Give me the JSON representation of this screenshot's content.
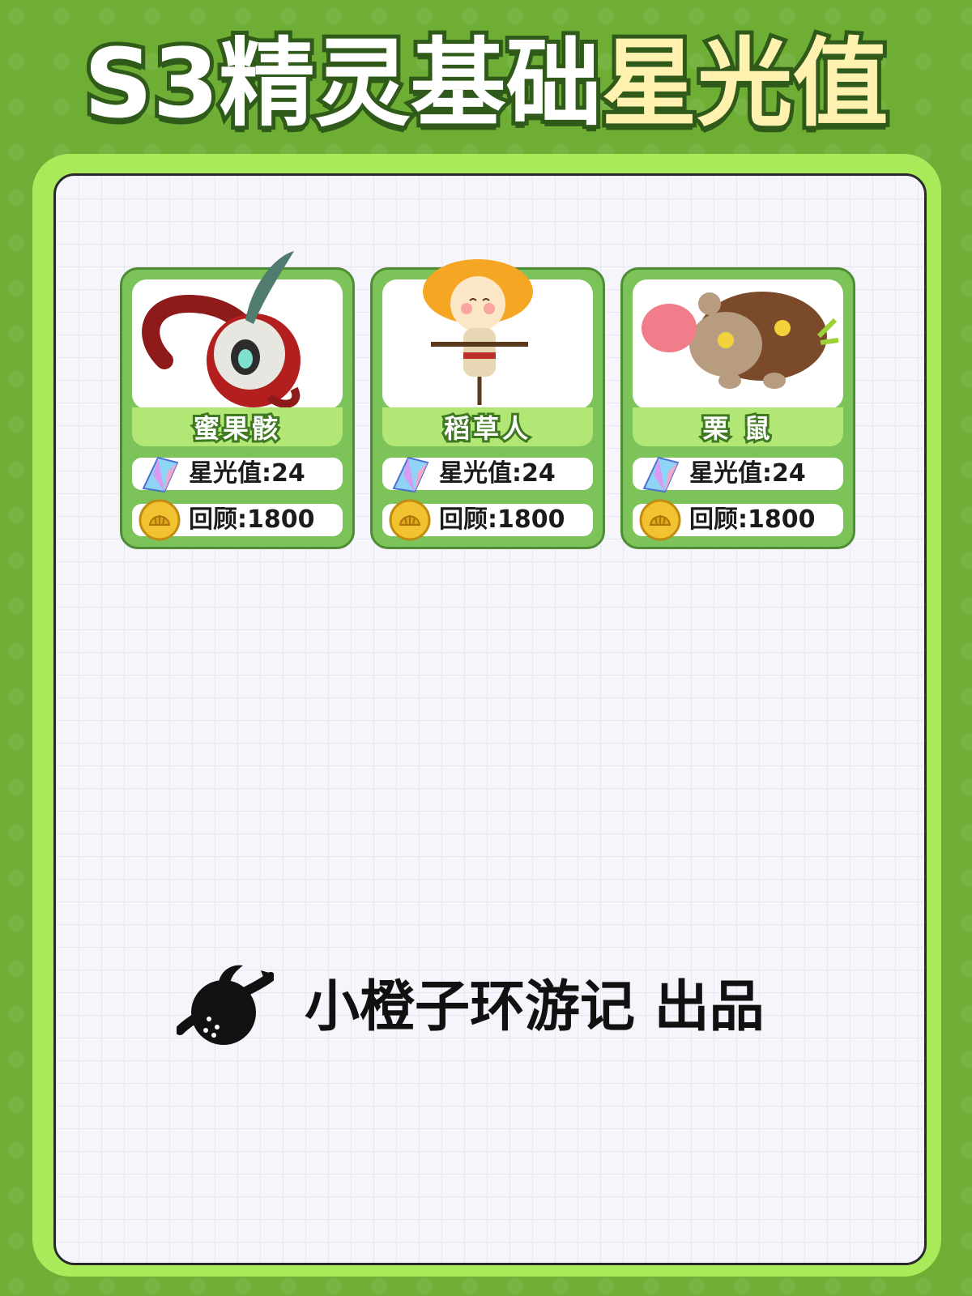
{
  "title": {
    "part1": "S3精灵基础",
    "part2": "星光值"
  },
  "cards": [
    {
      "name": "蜜果骸",
      "starlight": "星光值:24",
      "review": "回顾:1800",
      "art_icon": "fruit-skull-creature-icon"
    },
    {
      "name": "稻草人",
      "starlight": "星光值:24",
      "review": "回顾:1800",
      "art_icon": "scarecrow-creature-icon"
    },
    {
      "name": "栗 鼠",
      "starlight": "星光值:24",
      "review": "回顾:1800",
      "art_icon": "chestnut-rodent-creature-icon"
    }
  ],
  "icons": {
    "starlight": "crystal-icon",
    "review": "gold-shell-coin-icon",
    "credit": "planet-logo-icon"
  },
  "credit": {
    "text": "小橙子环游记 出品"
  },
  "colors": {
    "background": "#6eae35",
    "frame": "#a8ea5a",
    "card": "#7cc35a",
    "title_accent": "#fff2b0"
  }
}
